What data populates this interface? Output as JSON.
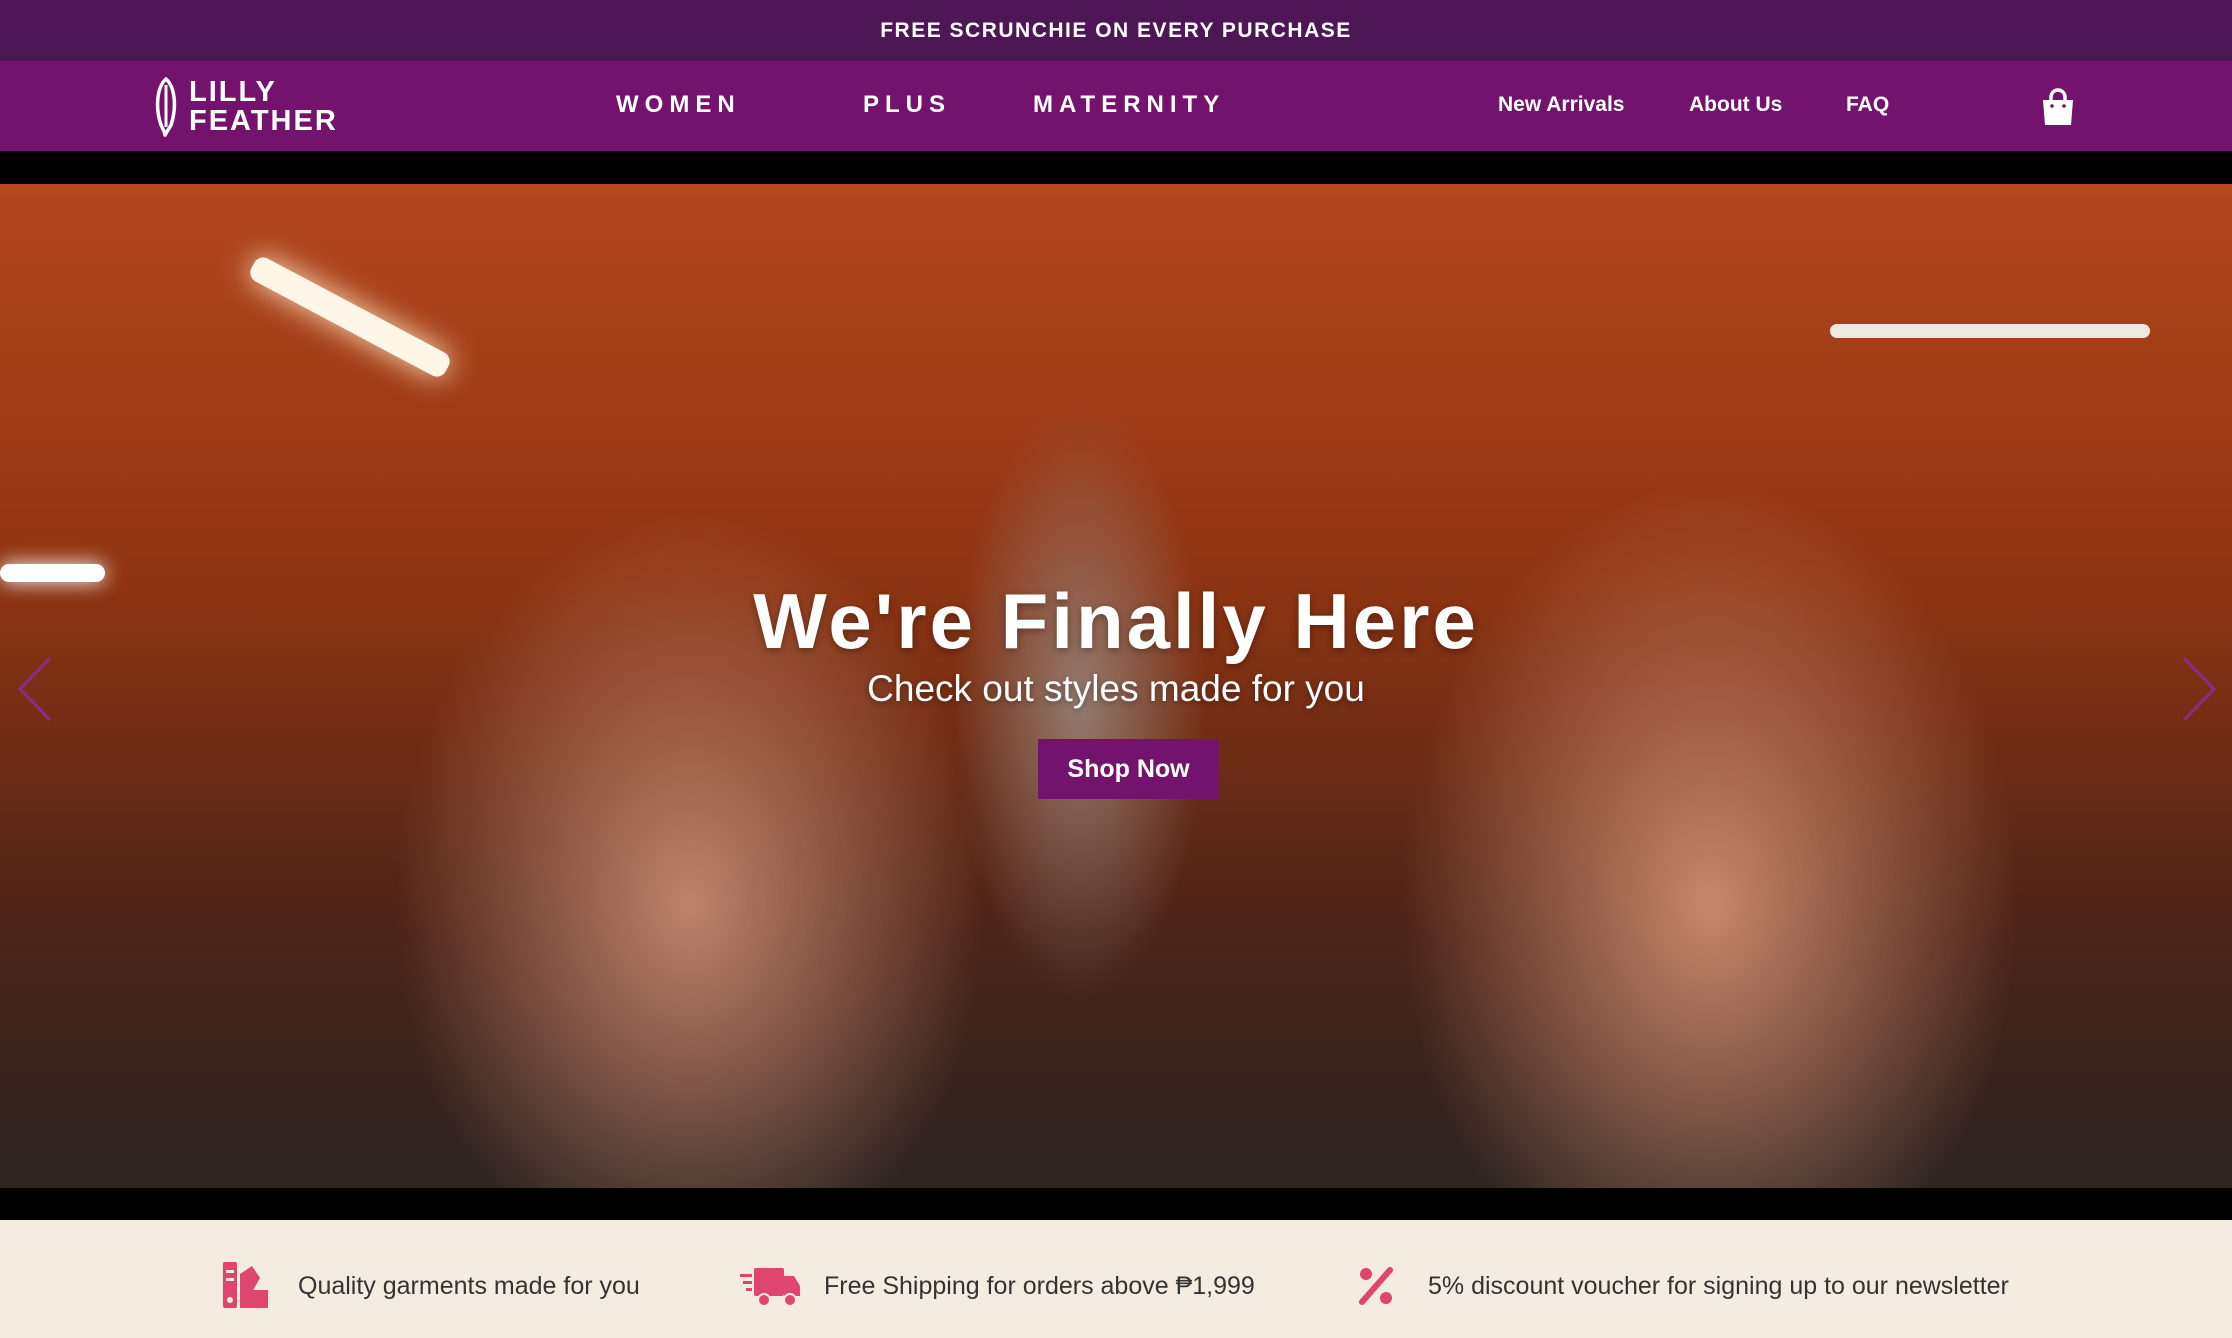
{
  "announcement": {
    "text": "FREE SCRUNCHIE ON EVERY PURCHASE"
  },
  "header": {
    "logo": {
      "line1": "LILLY",
      "line2": "FEATHER"
    },
    "main_nav": [
      "WOMEN",
      "PLUS",
      "MATERNITY"
    ],
    "util_nav": [
      "New Arrivals",
      "About Us",
      "FAQ"
    ],
    "cart_icon": "shopping-bag-icon"
  },
  "hero": {
    "title": "We're Finally Here",
    "subtitle": "Check out styles made for you",
    "cta_label": "Shop Now",
    "prev_icon": "chevron-left-icon",
    "next_icon": "chevron-right-icon",
    "slides_total": 1,
    "active_slide": 1
  },
  "features": [
    {
      "icon": "swatch-icon",
      "text": "Quality garments made for you"
    },
    {
      "icon": "delivery-truck-icon",
      "text": "Free Shipping for orders above ₱1,999"
    },
    {
      "icon": "percent-icon",
      "text": "5% discount voucher for signing up to our newsletter"
    }
  ],
  "colors": {
    "announcement_bg": "#4d1655",
    "header_bg": "#73136e",
    "accent": "#73136e",
    "feature_icon": "#e0456d",
    "features_bg": "#f5ece1"
  }
}
